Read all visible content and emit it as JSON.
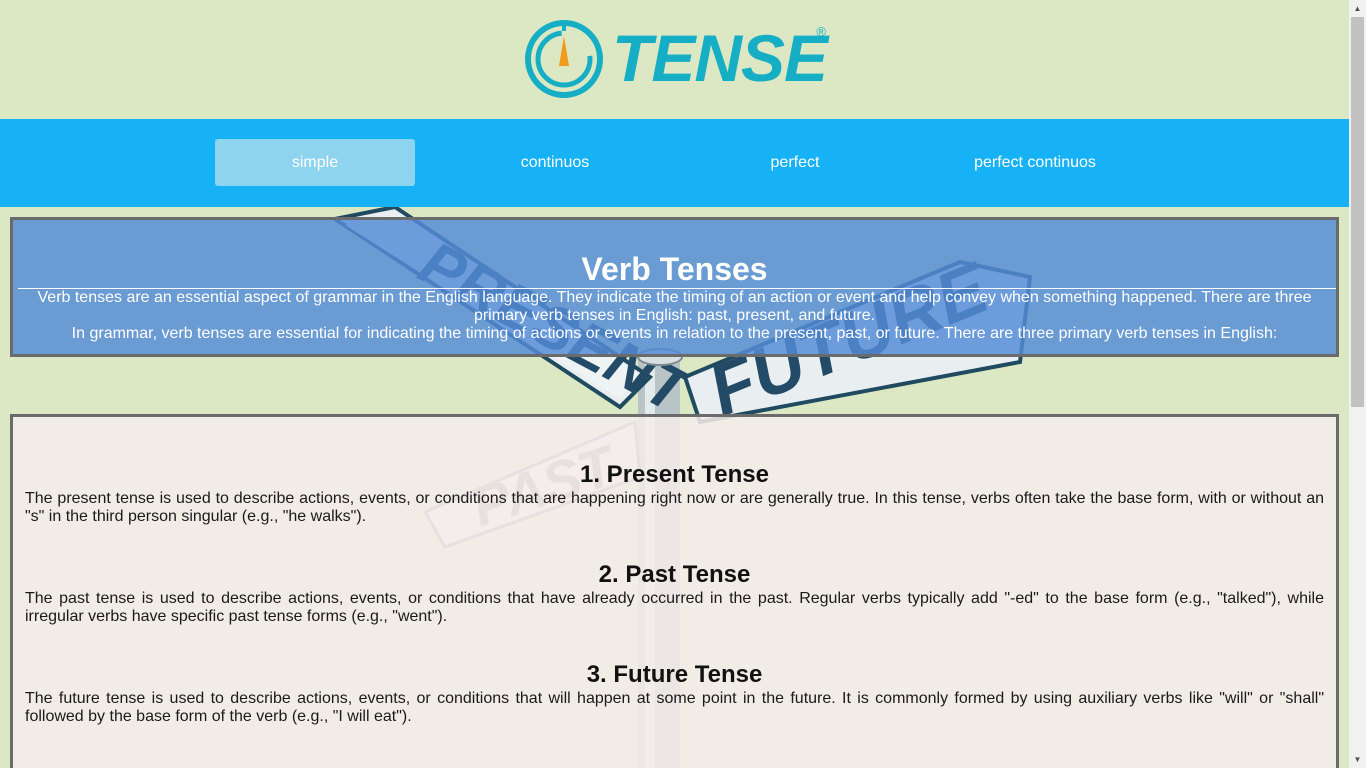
{
  "brand": {
    "name": "Tense",
    "registered": "®",
    "logo_text": "TENSE"
  },
  "nav": {
    "items": [
      {
        "label": "simple",
        "active": true
      },
      {
        "label": "continuos",
        "active": false
      },
      {
        "label": "perfect",
        "active": false
      },
      {
        "label": "perfect continuos",
        "active": false
      }
    ]
  },
  "sign": {
    "present": "PRESENT",
    "future": "FUTURE",
    "past": "PAST"
  },
  "hero": {
    "title": "Verb Tenses",
    "paragraph1": "Verb tenses are an essential aspect of grammar in the English language. They indicate the timing of an action or event and help convey when something happened. There are three primary verb tenses in English: past, present, and future.",
    "paragraph2": "In grammar, verb tenses are essential for indicating the timing of actions or events in relation to the present, past, or future. There are three primary verb tenses in English:"
  },
  "sections": [
    {
      "title": "1. Present Tense",
      "text": "The present tense is used to describe actions, events, or conditions that are happening right now or are generally true. In this tense, verbs often take the base form, with or without an \"s\" in the third person singular (e.g., \"he walks\")."
    },
    {
      "title": "2. Past Tense",
      "text": "The past tense is used to describe actions, events, or conditions that have already occurred in the past. Regular verbs typically add \"-ed\" to the base form (e.g., \"talked\"), while irregular verbs have specific past tense forms (e.g., \"went\")."
    },
    {
      "title": "3. Future Tense",
      "text": "The future tense is used to describe actions, events, or conditions that will happen at some point in the future. It is commonly formed by using auxiliary verbs like \"will\" or \"shall\" followed by the base form of the verb (e.g., \"I will eat\")."
    }
  ],
  "colors": {
    "page_bg": "#dce8c3",
    "nav_bg": "#16b2f5",
    "nav_active": "#8fd4ee",
    "brand": "#16aec5",
    "hero_bg": "#548cd6",
    "content_bg": "#f4ecea"
  },
  "icons": {
    "logo": "compass-icon",
    "scroll_up": "arrow-up-icon",
    "scroll_down": "arrow-down-icon"
  }
}
